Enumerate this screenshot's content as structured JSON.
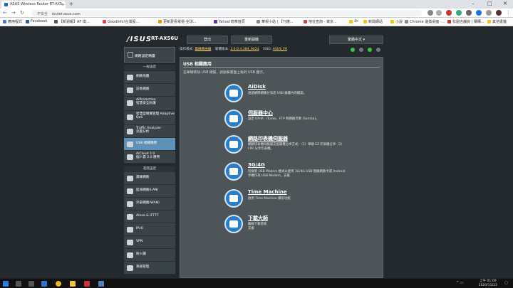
{
  "browser": {
    "tab_title": "ASUS Wireless Router RT-AX5...",
    "url_security": "不安全",
    "url": "router.asus.com",
    "bookmarks": [
      "應用程式",
      "Facebook",
      "【新週報】AF 徵...",
      "Goodinfo!台灣股...",
      "更新愛看電視-全球...",
      "Yahoo!奇摩首頁",
      "華視小站 | 【刊蓬...",
      "地址查詢 - 東京...",
      "3c",
      "新聞網站",
      "小說",
      "Chrome 邊換桌面 -...",
      "松屋店舗資 | 購購...",
      "其他書籤"
    ]
  },
  "router": {
    "brand": "/ISUS",
    "model": "RT-AX56U",
    "top_buttons": [
      "登出",
      "重新開機",
      "繁體中文"
    ],
    "status": {
      "mode_label": "操作模式:",
      "mode_value": "無線路由器",
      "fw_label": "韌體版本:",
      "fw_value": "3.0.0.4.384_9424",
      "ssid_label": "SSID:",
      "ssid_value": "ASUS_F0"
    }
  },
  "sidebar": {
    "qis": "網路設定精靈",
    "general_header": "一般設定",
    "general": [
      {
        "label": "網路地圖",
        "icon": "network-map-icon"
      },
      {
        "label": "訪客網路",
        "icon": "guest-network-icon"
      },
      {
        "label": "AiProtection\n智慧安全防護",
        "icon": "shield-icon"
      },
      {
        "label": "智慧型頻寬管理 Adaptive\nQoS",
        "icon": "qos-icon"
      },
      {
        "label": "Traffic Analyzer\n流量分析",
        "icon": "chart-icon"
      },
      {
        "label": "USB 相關應用",
        "icon": "usb-icon"
      },
      {
        "label": "AiCloud 2.0\n個人雲 2.0 應用",
        "icon": "cloud-icon"
      }
    ],
    "advanced_header": "進階設定",
    "advanced": [
      {
        "label": "無線網路",
        "icon": "wifi-icon"
      },
      {
        "label": "區域網路(LAN)",
        "icon": "lan-icon"
      },
      {
        "label": "外部網路(WAN)",
        "icon": "globe-icon"
      },
      {
        "label": "Alexa & IFTTT",
        "icon": "alexa-icon"
      },
      {
        "label": "IPv6",
        "icon": "ipv6-icon"
      },
      {
        "label": "VPN",
        "icon": "vpn-icon"
      },
      {
        "label": "防火牆",
        "icon": "firewall-icon"
      },
      {
        "label": "系統管理",
        "icon": "admin-icon"
      }
    ]
  },
  "content": {
    "title": "USB 相關應用",
    "subtitle": "在華碩移除 USB 硬碟，請點擊畫面上角的 USB 圖示。",
    "items": [
      {
        "title": "AiDisk",
        "desc": "透過網際網路分享您 USB 磁碟內的檔案。"
      },
      {
        "title": "伺服器中心",
        "desc": "設定 UPnP、iTunes、FTP 和網路芳鄰 (Samba)。"
      },
      {
        "title": "網路印表機伺服器",
        "desc": "網路印表機伺服器支援兩種分享方式：（1）華碩 EZ 印表機分享（2）LPR 分享印表機。"
      },
      {
        "title": "3G/4G",
        "desc": "切換到 USB Modem 模式以使用 3G/4G USB 無線網路卡或 Android 手機作為 USB Modem。支援"
      },
      {
        "title": "Time Machine",
        "desc": "啟用 Time Machine 備份功能"
      },
      {
        "title": "下載大師",
        "desc": "離線下載管家\n支援"
      }
    ]
  },
  "taskbar": {
    "time": "上午 01:09",
    "date": "2020/11/22"
  }
}
